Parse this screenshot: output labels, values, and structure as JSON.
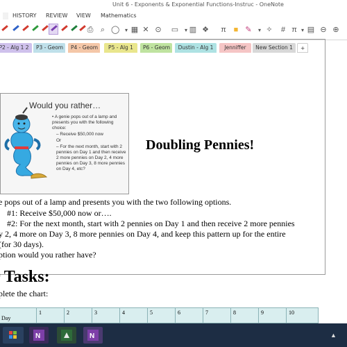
{
  "window": {
    "title": "Unit 6 - Exponents & Exponential Functions-Instruc - OneNote"
  },
  "menu": {
    "history": "HISTORY",
    "review": "REVIEW",
    "view": "VIEW",
    "mathematics": "Mathematics"
  },
  "toolbar": {
    "pen_colors": [
      "#d23a2f",
      "#2f62c8",
      "#d23a2f",
      "#2e9a3c",
      "#7a3fb0",
      "#d23a2f",
      "#1f7f3b",
      "#d23a2f",
      "#1a9a4a"
    ]
  },
  "tabs": [
    {
      "label": "P2 - Alg 1 2",
      "color": "#cfc1ec"
    },
    {
      "label": "P3 - Geom",
      "color": "#bfe0ea"
    },
    {
      "label": "P4 - Geom",
      "color": "#f4c7a8"
    },
    {
      "label": "P5 - Alg 1",
      "color": "#e9e68d"
    },
    {
      "label": "P6 - Geom",
      "color": "#bfe3a0"
    },
    {
      "label": "Dustin - Alg 1",
      "color": "#aee2e3"
    },
    {
      "label": "Jenniffer",
      "color": "#f5c5c5"
    },
    {
      "label": "New Section 1",
      "color": "#d8d8d8"
    },
    {
      "label": "+",
      "color": "#ffffff"
    }
  ],
  "slide": {
    "title": "Would you rather…",
    "bullets": [
      "• A genie pops out of a lamp and presents you with the following choice:",
      "– Receive $50,000 now",
      "Or",
      "– For the next month, start with 2 pennies on Day 1 and then receive 2 more pennies on Day 2, 4 more pennies on Day 3, 8 more pennies on Day 4, etc?"
    ]
  },
  "doc": {
    "title": "Doubling Pennies!",
    "lines": [
      "e pops out of a lamp and presents you with the two following options.",
      "#1:   Receive $50,000 now or….",
      "#2:  For the next month, start with 2 pennies on Day 1 and then receive 2 more pennies",
      "y 2, 4 more on Day 3, 8 more pennies on Day 4, and keep this pattern up for the entire",
      "(for 30 days).",
      "ption would you rather have?"
    ],
    "tasks_heading": "r Tasks:",
    "tasks_line": "plete the chart:"
  },
  "chart_table": {
    "row_label": "Day",
    "days": [
      "1",
      "2",
      "3",
      "4",
      "5",
      "6",
      "7",
      "8",
      "9",
      "10"
    ]
  }
}
